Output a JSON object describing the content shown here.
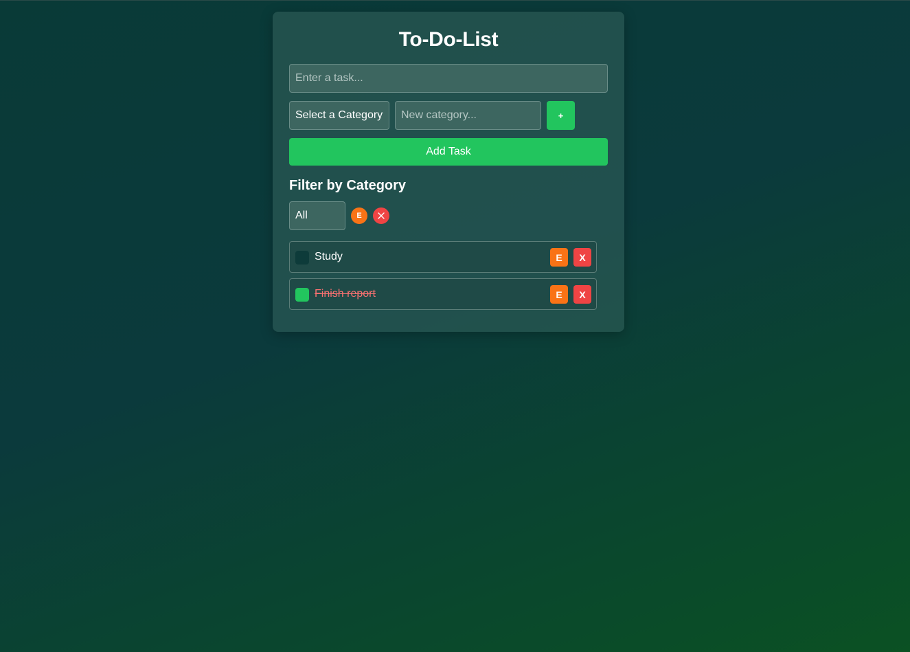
{
  "app": {
    "title": "To-Do-List"
  },
  "task_input": {
    "value": "",
    "placeholder": "Enter a task..."
  },
  "category": {
    "selected": "Select a Category",
    "new_placeholder": "New category...",
    "add_label": "+"
  },
  "add_task_label": "Add Task",
  "filter": {
    "heading": "Filter by Category",
    "selected": "All",
    "edit_label": "E"
  },
  "tasks": [
    {
      "text": "Study",
      "completed": false,
      "edit_label": "E",
      "delete_label": "X"
    },
    {
      "text": "Finish report",
      "completed": true,
      "edit_label": "E",
      "delete_label": "X"
    }
  ],
  "colors": {
    "accent_green": "#22c55e",
    "edit_orange": "#f97316",
    "delete_red": "#ef4444",
    "done_text": "#f87171"
  }
}
